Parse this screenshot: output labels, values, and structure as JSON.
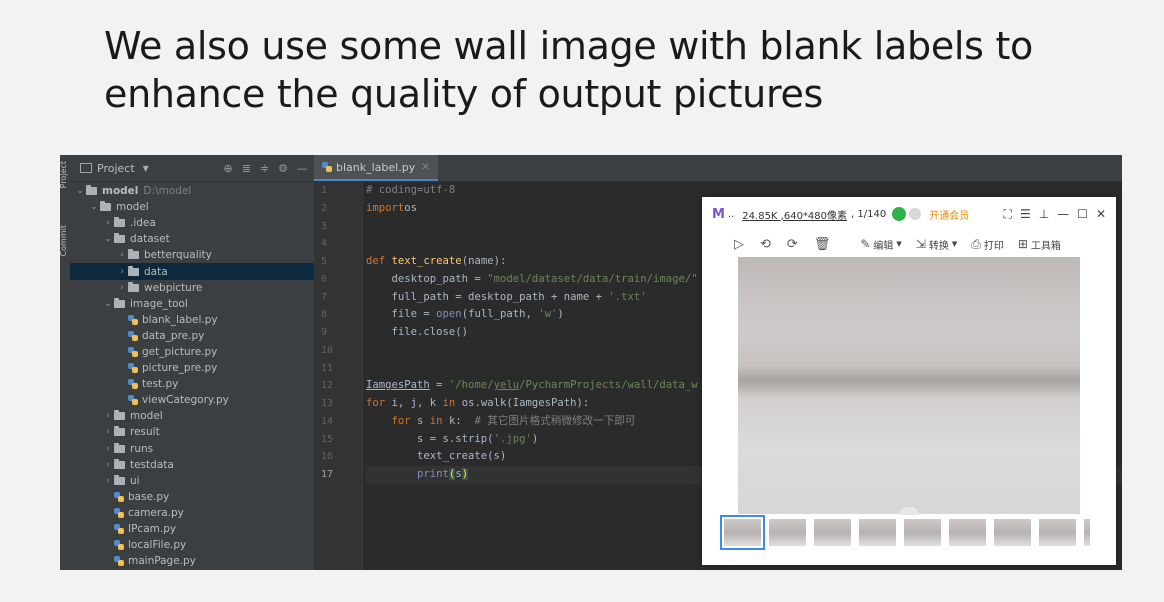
{
  "slide": {
    "title_line1": "We also use some wall image with blank labels to",
    "title_line2": "enhance the quality of output pictures"
  },
  "ide": {
    "side_tabs": {
      "project": "Project",
      "commit": "Commit"
    },
    "project_panel": {
      "title": "Project",
      "tree": [
        {
          "label": "model",
          "hint": "D:\\model",
          "type": "folder",
          "depth": 0,
          "expanded": true
        },
        {
          "label": "model",
          "type": "folder",
          "depth": 1,
          "expanded": true
        },
        {
          "label": ".idea",
          "type": "folder",
          "depth": 2,
          "expanded": false
        },
        {
          "label": "dataset",
          "type": "folder",
          "depth": 2,
          "expanded": true
        },
        {
          "label": "betterquality",
          "type": "folder",
          "depth": 3,
          "expanded": false
        },
        {
          "label": "data",
          "type": "folder",
          "depth": 3,
          "expanded": false,
          "selected": true
        },
        {
          "label": "webpicture",
          "type": "folder",
          "depth": 3,
          "expanded": false
        },
        {
          "label": "image_tool",
          "type": "folder",
          "depth": 2,
          "expanded": true
        },
        {
          "label": "blank_label.py",
          "type": "py",
          "depth": 3
        },
        {
          "label": "data_pre.py",
          "type": "py",
          "depth": 3
        },
        {
          "label": "get_picture.py",
          "type": "py",
          "depth": 3
        },
        {
          "label": "picture_pre.py",
          "type": "py",
          "depth": 3
        },
        {
          "label": "test.py",
          "type": "py",
          "depth": 3
        },
        {
          "label": "viewCategory.py",
          "type": "py",
          "depth": 3
        },
        {
          "label": "model",
          "type": "folder",
          "depth": 2,
          "expanded": false
        },
        {
          "label": "result",
          "type": "folder",
          "depth": 2,
          "expanded": false
        },
        {
          "label": "runs",
          "type": "folder",
          "depth": 2,
          "expanded": false
        },
        {
          "label": "testdata",
          "type": "folder",
          "depth": 2,
          "expanded": false
        },
        {
          "label": "ui",
          "type": "folder",
          "depth": 2,
          "expanded": false
        },
        {
          "label": "base.py",
          "type": "py",
          "depth": 2
        },
        {
          "label": "camera.py",
          "type": "py",
          "depth": 2
        },
        {
          "label": "IPcam.py",
          "type": "py",
          "depth": 2
        },
        {
          "label": "localFile.py",
          "type": "py",
          "depth": 2
        },
        {
          "label": "mainPage.py",
          "type": "py",
          "depth": 2
        }
      ]
    },
    "editor": {
      "tab_label": "blank_label.py",
      "current_line": 17,
      "line_numbers": [
        "1",
        "2",
        "3",
        "4",
        "5",
        "6",
        "7",
        "8",
        "9",
        "10",
        "11",
        "12",
        "13",
        "14",
        "15",
        "16",
        "17"
      ],
      "lines": [
        [
          [
            "cm",
            "# coding=utf-8"
          ]
        ],
        [
          [
            "kw",
            "import"
          ],
          [
            "",
            "os"
          ]
        ],
        [],
        [],
        [
          [
            "kw",
            "def "
          ],
          [
            "fn",
            "text_create"
          ],
          [
            "",
            "(name):"
          ]
        ],
        [
          [
            "",
            "    desktop_path = "
          ],
          [
            "st",
            "\"model/dataset/data/train/image/\""
          ]
        ],
        [
          [
            "",
            "    full_path = desktop_path + name + "
          ],
          [
            "st",
            "'.txt'"
          ]
        ],
        [
          [
            "",
            "    file = "
          ],
          [
            "bi",
            "open"
          ],
          [
            "",
            "(full_path, "
          ],
          [
            "st",
            "'w'"
          ],
          [
            "",
            ")"
          ]
        ],
        [
          [
            "",
            "    file.close()"
          ]
        ],
        [],
        [],
        [
          [
            "ul",
            "IamgesPath"
          ],
          [
            "",
            " = "
          ],
          [
            "st",
            "'/home/"
          ],
          [
            "st ul",
            "yelu"
          ],
          [
            "st",
            "/PycharmProjects/wall/data_w"
          ]
        ],
        [
          [
            "kw",
            "for "
          ],
          [
            "",
            "i, j, k "
          ],
          [
            "kw",
            "in "
          ],
          [
            "",
            "os.walk(IamgesPath):"
          ]
        ],
        [
          [
            "kw",
            "    for "
          ],
          [
            "",
            "s "
          ],
          [
            "kw",
            "in "
          ],
          [
            "",
            "k:  "
          ],
          [
            "cm",
            "# 其它图片格式稍微修改一下即可"
          ]
        ],
        [
          [
            "",
            "        s = s.strip("
          ],
          [
            "st",
            "'.jpg'"
          ],
          [
            "",
            ")"
          ]
        ],
        [
          [
            "",
            "        text_create(s)"
          ]
        ],
        [
          [
            "bi",
            "        print"
          ],
          [
            "hl",
            "("
          ],
          [
            "",
            "s"
          ],
          [
            "hl",
            ")"
          ]
        ]
      ]
    }
  },
  "viewer": {
    "logo": "M",
    "dots": "..",
    "meta": "24.85K ,640*480像素",
    "index": ", 1/140",
    "vip_label": "开通会员",
    "window_buttons": [
      "⛶",
      "☰",
      "⊥",
      "—",
      "☐",
      "✕"
    ],
    "tools": {
      "edit": "编辑",
      "convert": "转换",
      "print": "打印",
      "toolbox": "工具箱"
    },
    "thumbnail_count": 9,
    "active_thumbnail": 1
  }
}
